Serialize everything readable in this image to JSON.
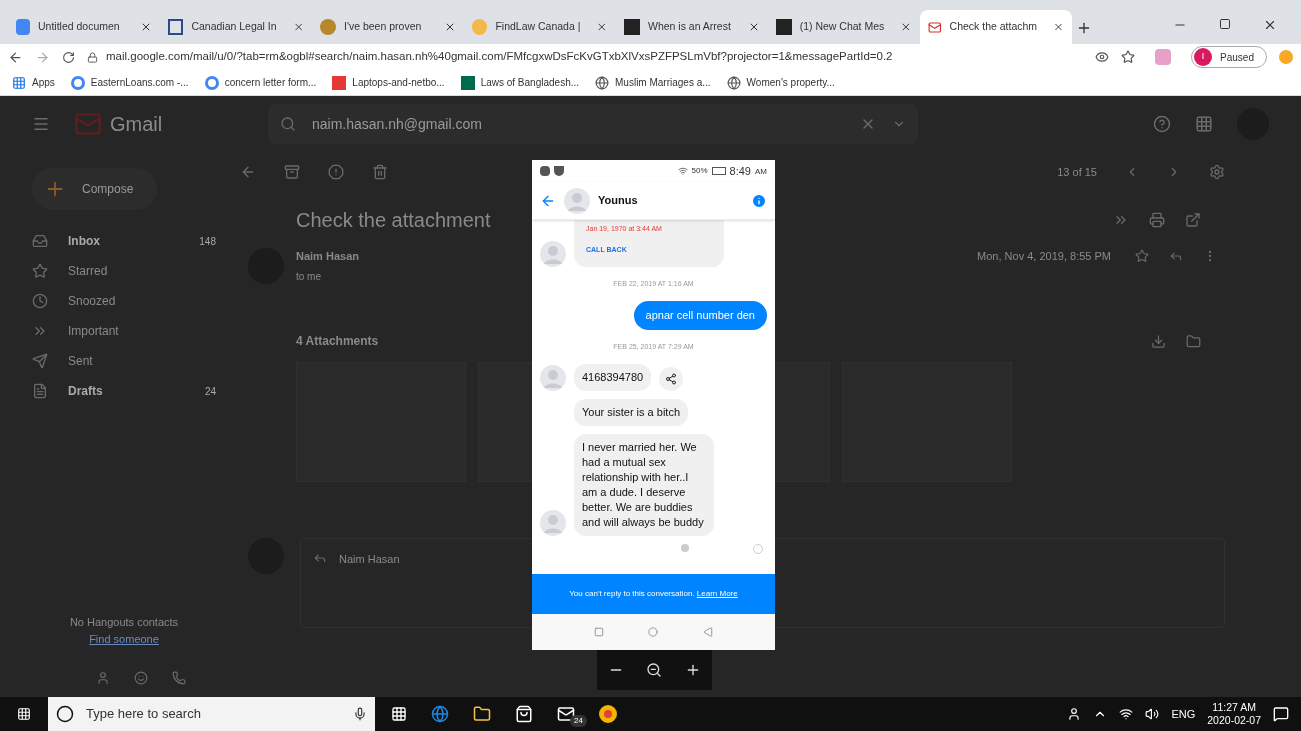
{
  "browser": {
    "tabs": [
      {
        "title": "Untitled documen",
        "selected": false
      },
      {
        "title": "Canadian Legal In",
        "selected": false
      },
      {
        "title": "I've been proven",
        "selected": false
      },
      {
        "title": "FindLaw Canada |",
        "selected": false
      },
      {
        "title": "When is an Arrest",
        "selected": false
      },
      {
        "title": "(1) New Chat Mes",
        "selected": false
      },
      {
        "title": "Check the attachm",
        "selected": true
      }
    ],
    "url": "mail.google.com/mail/u/0/?tab=rm&ogbl#search/naim.hasan.nh%40gmail.com/FMfcgxwDsFcKvGTxbXlVxsPZFPSLmVbf?projector=1&messagePartId=0.2",
    "profile": {
      "initial": "I",
      "status": "Paused"
    },
    "bookmarks": [
      {
        "title": "Apps"
      },
      {
        "title": "EasternLoans.com -..."
      },
      {
        "title": "concern letter form..."
      },
      {
        "title": "Laptops-and-netbo..."
      },
      {
        "title": "Laws of Bangladesh..."
      },
      {
        "title": "Muslim Marriages a..."
      },
      {
        "title": "Women's property..."
      }
    ]
  },
  "gmail": {
    "logo": "Gmail",
    "search_value": "naim.hasan.nh@gmail.com",
    "compose": "Compose",
    "nav": [
      {
        "label": "Inbox",
        "count": "148",
        "unread": true
      },
      {
        "label": "Starred",
        "unread": false
      },
      {
        "label": "Snoozed",
        "unread": false
      },
      {
        "label": "Important",
        "unread": false
      },
      {
        "label": "Sent",
        "unread": false
      },
      {
        "label": "Drafts",
        "count": "24",
        "unread": true
      }
    ],
    "hangouts": {
      "empty_text": "No Hangouts contacts",
      "link": "Find someone"
    },
    "pager": "13 of 15",
    "subject": "Check the attachment",
    "sender": "Naim Hasan",
    "recipient": "to me",
    "date": "Mon, Nov 4, 2019, 8:55 PM",
    "attachments_heading": "4 Attachments",
    "reply_to": "Naim Hasan"
  },
  "viewer": {
    "status_time": "8:49",
    "status_ampm": "AM",
    "battery": "50%",
    "contact": "Younus",
    "messages": [
      {
        "kind": "call",
        "time": "Jan 19, 1970 at 3:44 AM",
        "action": "CALL BACK"
      },
      {
        "kind": "timestamp",
        "text": "FEB 22, 2019 AT 1:16 AM"
      },
      {
        "kind": "outgoing",
        "text": "apnar cell number den"
      },
      {
        "kind": "timestamp",
        "text": "FEB 25, 2019 AT 7:29 AM"
      },
      {
        "kind": "incoming",
        "text": "4168394780",
        "share": true,
        "avatar": true
      },
      {
        "kind": "incoming",
        "text": "Your sister is a bitch",
        "share": false,
        "avatar": false
      },
      {
        "kind": "incoming",
        "text": "I never married her. We had a mutual sex relationship with her..I am a dude. I deserve better. We are buddies and will always be buddy",
        "share": false,
        "avatar": true
      }
    ],
    "notice": "You can't reply to this conversation.",
    "notice_link": "Learn More"
  },
  "taskbar": {
    "search_placeholder": "Type here to search",
    "mail_badge": "24",
    "language": "ENG",
    "time": "11:27 AM",
    "date": "2020-02-07"
  }
}
